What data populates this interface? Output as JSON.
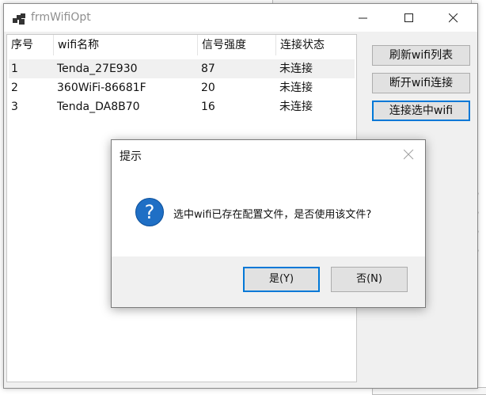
{
  "window": {
    "title": "frmWifiOpt",
    "controls": [
      "minimize-icon",
      "maximize-icon",
      "close-icon"
    ]
  },
  "list": {
    "columns": [
      "序号",
      "wifi名称",
      "信号强度",
      "连接状态"
    ],
    "rows": [
      {
        "no": "1",
        "name": "Tenda_27E930",
        "signal": "87",
        "status": "未连接"
      },
      {
        "no": "2",
        "name": "360WiFi-86681F",
        "signal": "20",
        "status": "未连接"
      },
      {
        "no": "3",
        "name": "Tenda_DA8B70",
        "signal": "16",
        "status": "未连接"
      }
    ]
  },
  "buttons": {
    "refresh": "刷新wifi列表",
    "disconnect": "断开wifi连接",
    "connect": "连接选中wifi"
  },
  "dialog": {
    "title": "提示",
    "icon": "question-icon",
    "icon_glyph": "?",
    "message": "选中wifi已存在配置文件，是否使用该文件?",
    "yes": "是(Y)",
    "no": "否(N)"
  },
  "colors": {
    "focus": "#0078d7",
    "question_icon": "#1f6fc5"
  }
}
